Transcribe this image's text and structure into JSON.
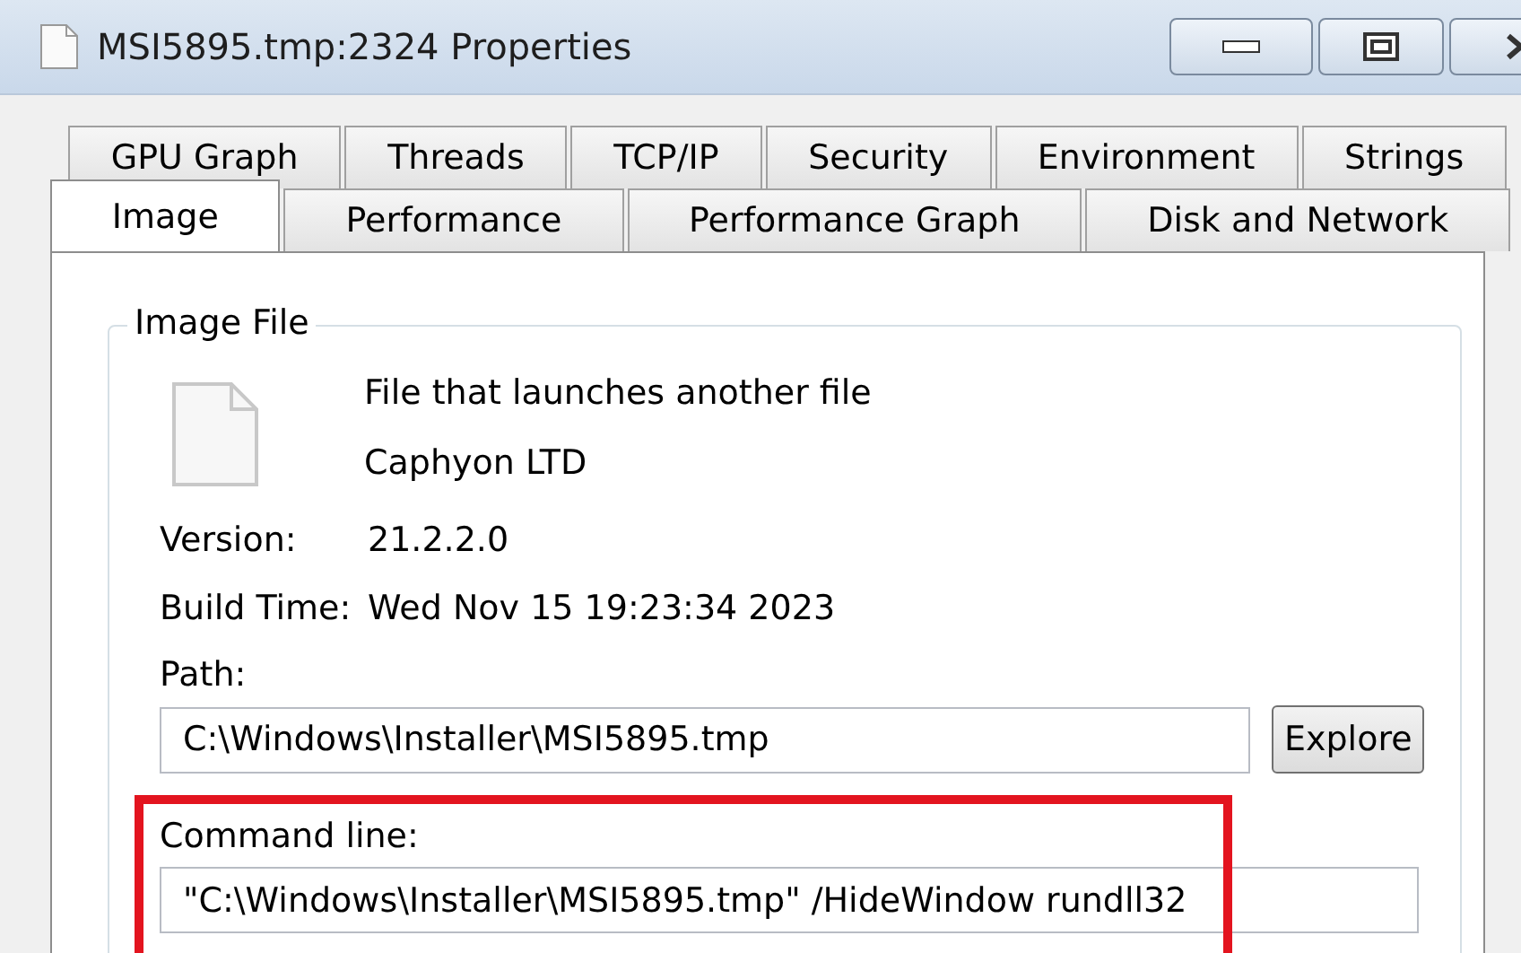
{
  "window": {
    "title": "MSI5895.tmp:2324 Properties"
  },
  "tab_rows": [
    {
      "tabs": [
        {
          "label": "GPU Graph",
          "selected": false
        },
        {
          "label": "Threads",
          "selected": false
        },
        {
          "label": "TCP/IP",
          "selected": false
        },
        {
          "label": "Security",
          "selected": false
        },
        {
          "label": "Environment",
          "selected": false
        },
        {
          "label": "Strings",
          "selected": false
        }
      ]
    },
    {
      "tabs": [
        {
          "label": "Image",
          "selected": true
        },
        {
          "label": "Performance",
          "selected": false
        },
        {
          "label": "Performance Graph",
          "selected": false
        },
        {
          "label": "Disk and Network",
          "selected": false
        }
      ]
    }
  ],
  "image_file": {
    "title": "Image File",
    "description": "File that launches another file",
    "company": "Caphyon LTD",
    "fields": [
      {
        "label": "Version:",
        "value": "21.2.2.0"
      },
      {
        "label": "Build Time:",
        "value": "Wed Nov 15 19:23:34 2023"
      }
    ],
    "path": {
      "label": "Path:",
      "value": "C:\\Windows\\Installer\\MSI5895.tmp",
      "button": "Explore"
    },
    "command_line": {
      "label": "Command line:",
      "value": "\"C:\\Windows\\Installer\\MSI5895.tmp\" /HideWindow rundll32",
      "highlighted": true
    }
  }
}
